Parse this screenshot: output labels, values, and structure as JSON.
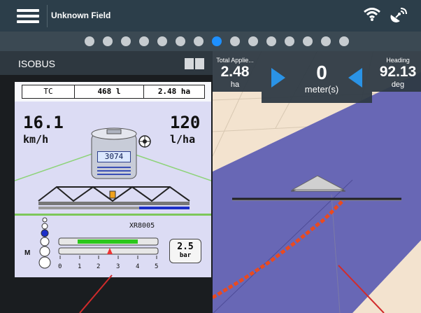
{
  "topbar": {
    "field_name": "Unknown Field",
    "icons": [
      "menu-icon",
      "wifi-icon",
      "satellite-icon"
    ]
  },
  "pager": {
    "count": 15,
    "active_index": 7,
    "active_color": "#1e90ff"
  },
  "isobus": {
    "title": "ISOBUS",
    "tc_label": "TC",
    "volume": "468 l",
    "area": "2.48 ha",
    "speed": "16.1",
    "speed_unit": "km/h",
    "rate": "120",
    "rate_unit": "l/ha",
    "tank_value": "3074",
    "model": "XR8005",
    "pressure_value": "2.5",
    "pressure_unit": "bar",
    "m_label": "M",
    "scale_labels": [
      "0",
      "1",
      "2",
      "3",
      "4",
      "5"
    ]
  },
  "map_info": {
    "total_applied_label": "Total Applie...",
    "total_applied_value": "2.48",
    "total_applied_unit": "ha",
    "offset_value": "0",
    "offset_unit": "meter(s)",
    "heading_label": "Heading",
    "heading_value": "92.13",
    "heading_unit": "deg"
  },
  "colors": {
    "topbar": "#2c3e4a",
    "field": "#6866b4",
    "ground": "#f2e3cf",
    "applied_trail": "#ea4a1f",
    "arrow": "#2a93e6"
  }
}
